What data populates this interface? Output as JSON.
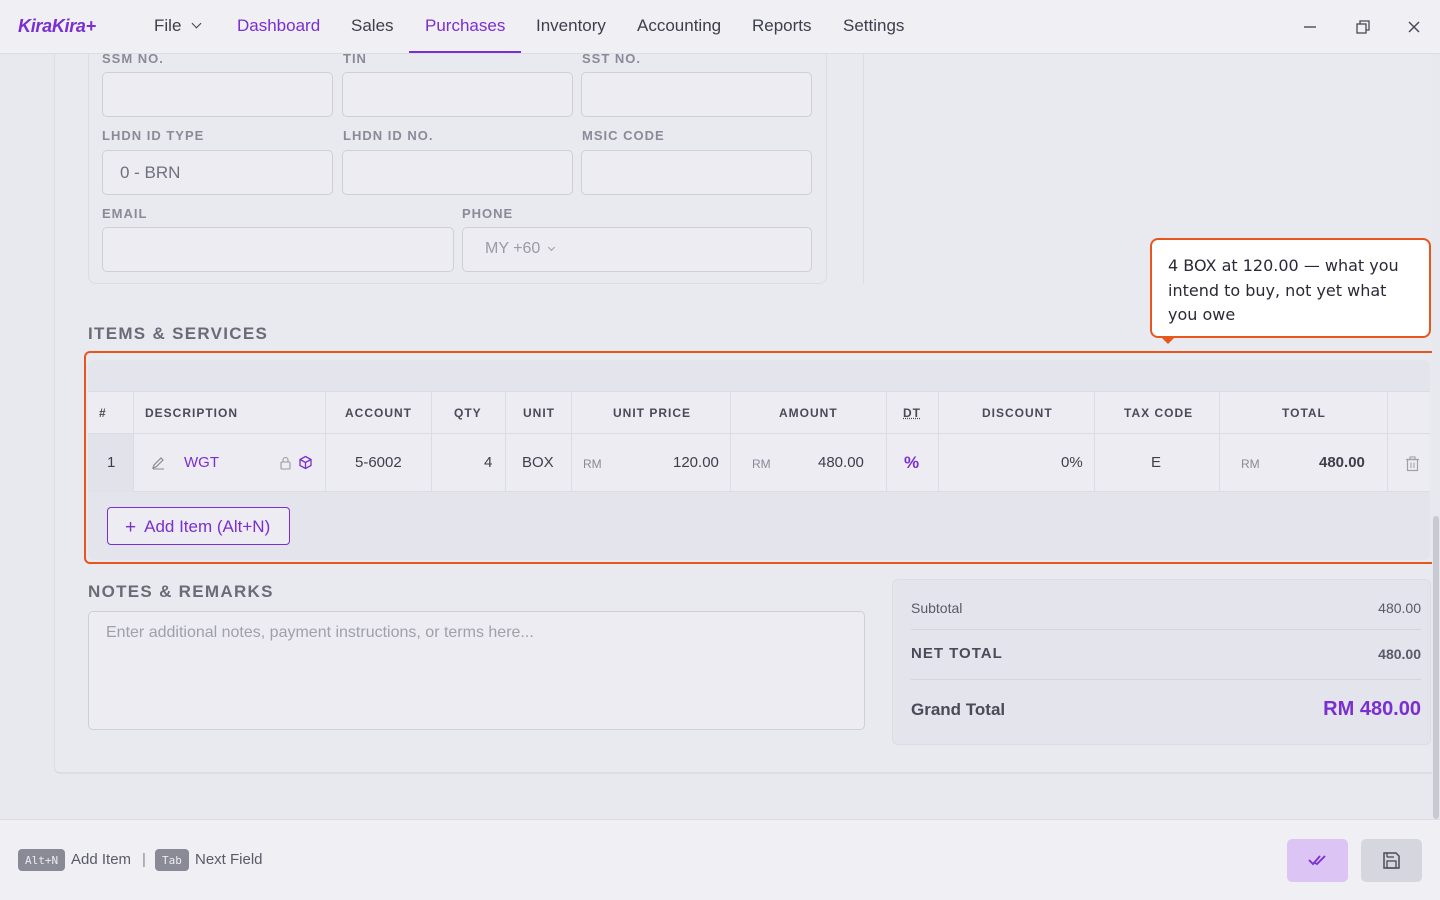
{
  "app": {
    "logo": "KiraKira+"
  },
  "nav": {
    "file": "File",
    "items": [
      "Dashboard",
      "Sales",
      "Purchases",
      "Inventory",
      "Accounting",
      "Reports",
      "Settings"
    ],
    "active": "Purchases"
  },
  "vendor": {
    "ssm_label": "SSM NO.",
    "tin_label": "TIN",
    "sst_label": "SST NO.",
    "lhdn_type_label": "LHDN ID TYPE",
    "lhdn_type_value": "0 - BRN",
    "lhdn_no_label": "LHDN ID NO.",
    "msic_label": "MSIC CODE",
    "email_label": "EMAIL",
    "phone_label": "PHONE",
    "phone_value": "MY +60"
  },
  "items": {
    "title": "ITEMS & SERVICES",
    "headers": {
      "num": "#",
      "description": "DESCRIPTION",
      "account": "ACCOUNT",
      "qty": "QTY",
      "unit": "UNIT",
      "unit_price": "UNIT PRICE",
      "amount": "AMOUNT",
      "dt": "DT",
      "discount": "DISCOUNT",
      "tax_code": "TAX CODE",
      "total": "TOTAL"
    },
    "rows": [
      {
        "num": "1",
        "description": "WGT",
        "account": "5-6002",
        "qty": "4",
        "unit": "BOX",
        "currency": "RM",
        "unit_price": "120.00",
        "amount": "480.00",
        "dt": "%",
        "discount": "0%",
        "tax_code": "E",
        "total": "480.00"
      }
    ],
    "add_button": "Add Item (Alt+N)"
  },
  "callout": {
    "text": "4 BOX at 120.00 — what you intend to buy, not yet what you owe"
  },
  "notes": {
    "title": "NOTES & REMARKS",
    "placeholder": "Enter additional notes, payment instructions, or terms here..."
  },
  "summary": {
    "subtotal_label": "Subtotal",
    "subtotal_value": "480.00",
    "net_label": "NET TOTAL",
    "net_value": "480.00",
    "grand_label": "Grand Total",
    "grand_value": "RM 480.00"
  },
  "footer": {
    "hint1_key": "Alt+N",
    "hint1_text": "Add Item",
    "separator": "|",
    "hint2_key": "Tab",
    "hint2_text": "Next Field"
  },
  "colors": {
    "accent": "#7a2fd0",
    "highlight": "#e8561e"
  }
}
